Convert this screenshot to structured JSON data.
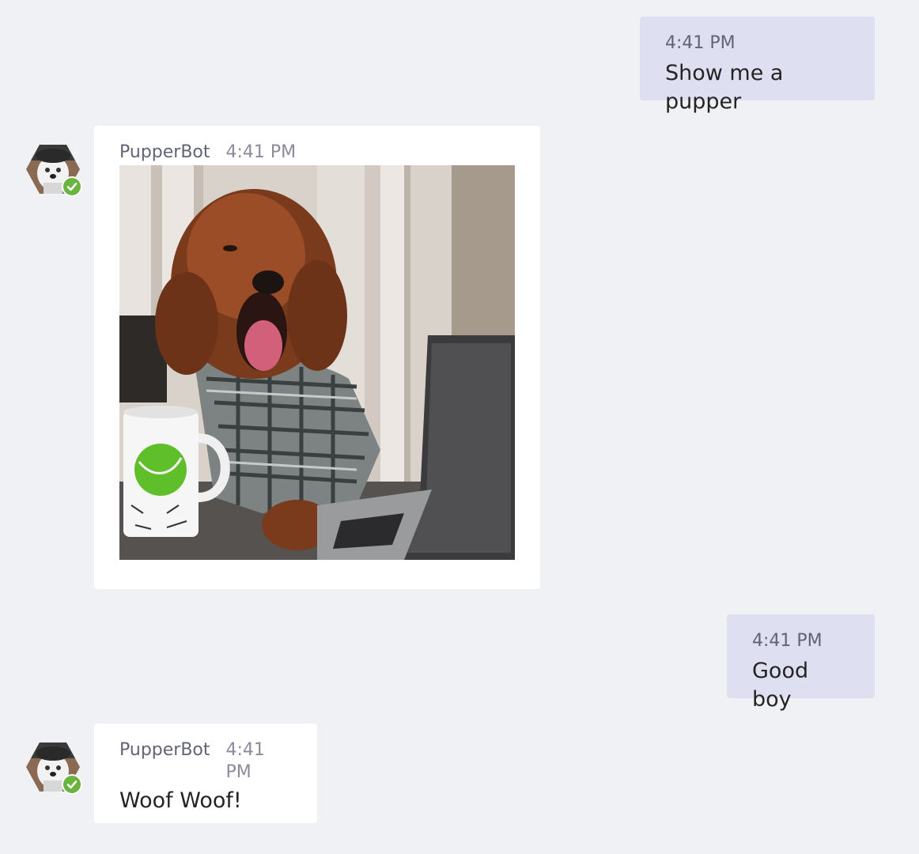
{
  "messages": [
    {
      "from": "user",
      "time": "4:41 PM",
      "text": "Show me a pupper"
    },
    {
      "from": "bot",
      "sender": "PupperBot",
      "time": "4:41 PM",
      "image_alt": "dog-in-plaid-shirt-at-laptop"
    },
    {
      "from": "user",
      "time": "4:41 PM",
      "text": "Good boy"
    },
    {
      "from": "bot",
      "sender": "PupperBot",
      "time": "4:41 PM",
      "text": "Woof Woof!"
    }
  ],
  "colors": {
    "background": "#f0f1f4",
    "outgoing_bubble": "#dfdff2",
    "incoming_bubble": "#ffffff",
    "status_online": "#6bb33f"
  },
  "icons": {
    "avatar": "pupperbot-avatar",
    "status": "online-check-icon"
  }
}
